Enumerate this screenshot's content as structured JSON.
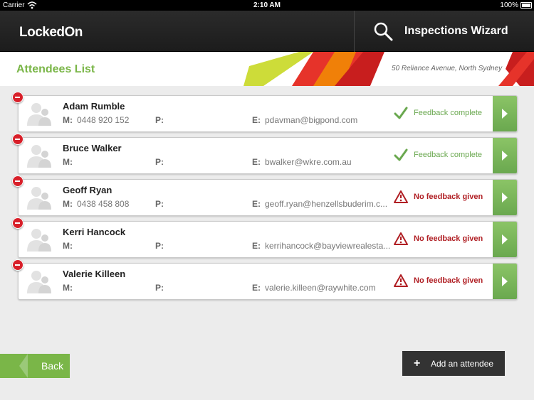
{
  "status_bar": {
    "carrier": "Carrier",
    "time": "2:10 AM",
    "battery": "100%"
  },
  "navbar": {
    "logo": "LockedOn",
    "title": "Inspections Wizard"
  },
  "header": {
    "title": "Attendees List",
    "address": "50 Reliance Avenue, North Sydney"
  },
  "attendees": [
    {
      "name": "Adam Rumble",
      "m_label": "M:",
      "mobile": "0448 920 152",
      "p_label": "P:",
      "phone": "",
      "e_label": "E:",
      "email": "pdavman@bigpond.com",
      "status": "Feedback complete",
      "state": "complete"
    },
    {
      "name": "Bruce Walker",
      "m_label": "M:",
      "mobile": "",
      "p_label": "P:",
      "phone": "",
      "e_label": "E:",
      "email": "bwalker@wkre.com.au",
      "status": "Feedback complete",
      "state": "complete"
    },
    {
      "name": "Geoff Ryan",
      "m_label": "M:",
      "mobile": "0438 458 808",
      "p_label": "P:",
      "phone": "",
      "e_label": "E:",
      "email": "geoff.ryan@henzellsbuderim.c...",
      "status": "No feedback given",
      "state": "none"
    },
    {
      "name": "Kerri Hancock",
      "m_label": "M:",
      "mobile": "",
      "p_label": "P:",
      "phone": "",
      "e_label": "E:",
      "email": "kerrihancock@bayviewrealesta...",
      "status": "No feedback given",
      "state": "none"
    },
    {
      "name": "Valerie Killeen",
      "m_label": "M:",
      "mobile": "",
      "p_label": "P:",
      "phone": "",
      "e_label": "E:",
      "email": "valerie.killeen@raywhite.com",
      "status": "No feedback given",
      "state": "none"
    }
  ],
  "footer": {
    "back_label": "Back",
    "add_label": "Add an attendee"
  },
  "colors": {
    "accent_green": "#7ab648",
    "warning_red": "#b01e23",
    "delete_red": "#d8202a",
    "dark": "#333333"
  },
  "icons": {
    "search": "search-icon",
    "complete": "checkmark-icon",
    "none": "warning-icon",
    "delete": "delete-icon",
    "go": "chevron-right-icon",
    "avatar": "person-placeholder-icon",
    "add": "plus-icon"
  }
}
